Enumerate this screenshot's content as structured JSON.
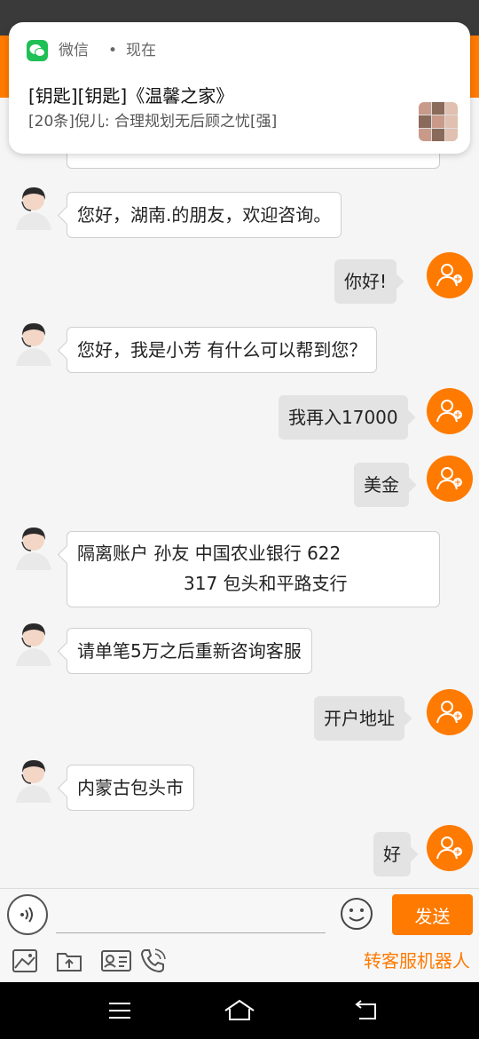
{
  "notification": {
    "app_name": "微信",
    "separator": "•",
    "time": "现在",
    "title": "[钥匙][钥匙]《温馨之家》",
    "body": "[20条]倪儿: 合理规划无后顾之忧[强]"
  },
  "messages": [
    {
      "from": "agent",
      "text": "您好，湖南.的朋友，欢迎咨询。"
    },
    {
      "from": "user",
      "text": "你好!"
    },
    {
      "from": "agent",
      "text": "您好，我是小芳 有什么可以帮到您？"
    },
    {
      "from": "user",
      "text": "我再入17000"
    },
    {
      "from": "user",
      "text": "美金"
    },
    {
      "from": "agent",
      "line1": "隔离账户 孙友 中国农业银行 622",
      "line2": "317 包头和平路支行"
    },
    {
      "from": "agent",
      "text": "请单笔5万之后重新咨询客服"
    },
    {
      "from": "user",
      "text": "开户地址"
    },
    {
      "from": "agent",
      "text": "内蒙古包头市"
    },
    {
      "from": "user",
      "text": "好"
    }
  ],
  "input": {
    "value": "",
    "send_label": "发送"
  },
  "toolbar": {
    "robot_label": "转客服机器人"
  },
  "colors": {
    "accent": "#ff7a00",
    "wechat_green": "#1fc055"
  }
}
